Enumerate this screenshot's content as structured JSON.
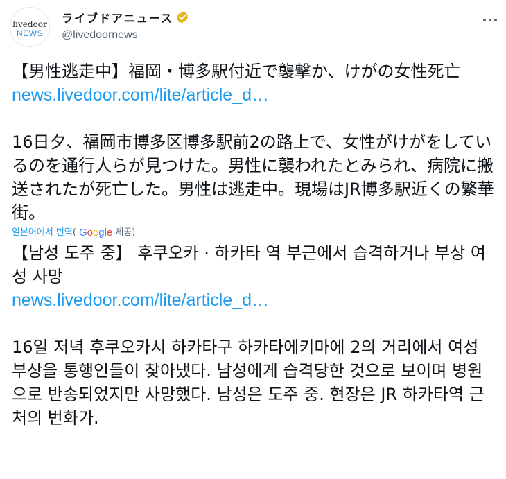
{
  "header": {
    "avatar": {
      "logo_top": "livedoor",
      "logo_bottom": "NEWS"
    },
    "display_name": "ライブドアニュース",
    "handle": "@livedoornews",
    "verified_icon": "verified-badge-icon",
    "more_icon": "more-options-icon"
  },
  "tweet": {
    "headline": "【男性逃走中】福岡・博多駅付近で襲撃か、けがの女性死亡",
    "link": "news.livedoor.com/lite/article_d…",
    "body": "16日夕、福岡市博多区博多駅前2の路上で、女性がけがをしているのを通行人らが見つけた。男性に襲われたとみられ、病院に搬送されたが死亡した。男性は逃走中。現場はJR博多駅近くの繁華街。"
  },
  "translation": {
    "label": "일본어에서 번역",
    "open_paren": "(",
    "google": "Google",
    "provided": " 제공)",
    "headline": "【남성 도주 중】 후쿠오카 · 하카타 역 부근에서 습격하거나 부상 여성 사망",
    "link": "news.livedoor.com/lite/article_d…",
    "body": "16일 저녁 후쿠오카시 하카타구 하카타에키마에 2의 거리에서 여성 부상을 통행인들이 찾아냈다. 남성에게 습격당한 것으로 보이며 병원으로 반송되었지만 사망했다. 남성은 도주 중. 현장은 JR 하카타역 근처의 번화가."
  },
  "colors": {
    "link": "#1d9bf0",
    "secondary_text": "#536471",
    "verified": "#e2b719"
  }
}
